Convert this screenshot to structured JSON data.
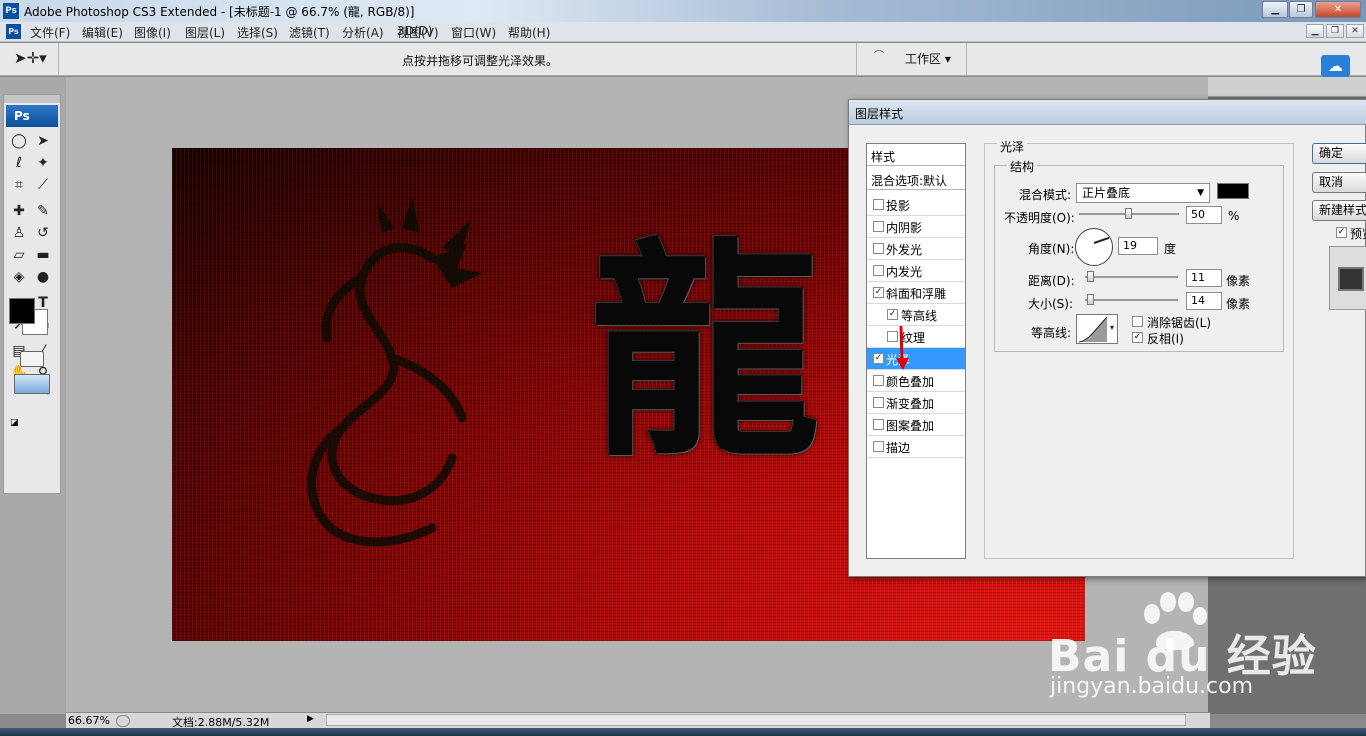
{
  "window": {
    "title": "Adobe Photoshop CS3 Extended - [未标题-1 @ 66.7% (龍, RGB/8)]",
    "app_icon": "Ps"
  },
  "menu": [
    "文件(F)",
    "编辑(E)",
    "图像(I)",
    "图层(L)",
    "选择(S)",
    "滤镜(T)",
    "分析(A)",
    "3D(D)",
    "视图(V)",
    "窗口(W)",
    "帮助(H)"
  ],
  "options": {
    "hint": "点按并拖移可调整光泽效果。",
    "workspace": "工作区 ▾"
  },
  "toolbox": {
    "logo": "Ps"
  },
  "canvas": {
    "character": "龍"
  },
  "dialog": {
    "title": "图层样式",
    "styles_header": "样式",
    "blend_options": "混合选项:默认",
    "styles": [
      {
        "label": "投影",
        "checked": false,
        "selected": false
      },
      {
        "label": "内阴影",
        "checked": false,
        "selected": false
      },
      {
        "label": "外发光",
        "checked": false,
        "selected": false
      },
      {
        "label": "内发光",
        "checked": false,
        "selected": false
      },
      {
        "label": "斜面和浮雕",
        "checked": true,
        "selected": false
      },
      {
        "label": "等高线",
        "checked": true,
        "selected": false,
        "sub": true
      },
      {
        "label": "纹理",
        "checked": false,
        "selected": false,
        "sub": true
      },
      {
        "label": "光泽",
        "checked": true,
        "selected": true
      },
      {
        "label": "颜色叠加",
        "checked": false,
        "selected": false
      },
      {
        "label": "渐变叠加",
        "checked": false,
        "selected": false
      },
      {
        "label": "图案叠加",
        "checked": false,
        "selected": false
      },
      {
        "label": "描边",
        "checked": false,
        "selected": false
      }
    ],
    "section_title": "光泽",
    "group_title": "结构",
    "blend_mode_label": "混合模式:",
    "blend_mode_value": "正片叠底",
    "opacity_label": "不透明度(O):",
    "opacity_value": "50",
    "opacity_unit": "%",
    "angle_label": "角度(N):",
    "angle_value": "19",
    "angle_unit": "度",
    "distance_label": "距离(D):",
    "distance_value": "11",
    "distance_unit": "像素",
    "size_label": "大小(S):",
    "size_value": "14",
    "size_unit": "像素",
    "contour_label": "等高线:",
    "antialias_label": "消除锯齿(L)",
    "invert_label": "反相(I)",
    "antialias_checked": false,
    "invert_checked": true,
    "buttons": {
      "ok": "确定",
      "cancel": "取消",
      "new_style": "新建样式...",
      "preview": "预览"
    }
  },
  "status": {
    "zoom": "66.67%",
    "doc": "文档:2.88M/5.32M"
  },
  "watermark": {
    "brand": "Bai du 经验",
    "url": "jingyan.baidu.com"
  },
  "colors": {
    "accent": "#3399ff",
    "canvas_red": "#d0100c",
    "dialog_bg": "#efefef"
  }
}
